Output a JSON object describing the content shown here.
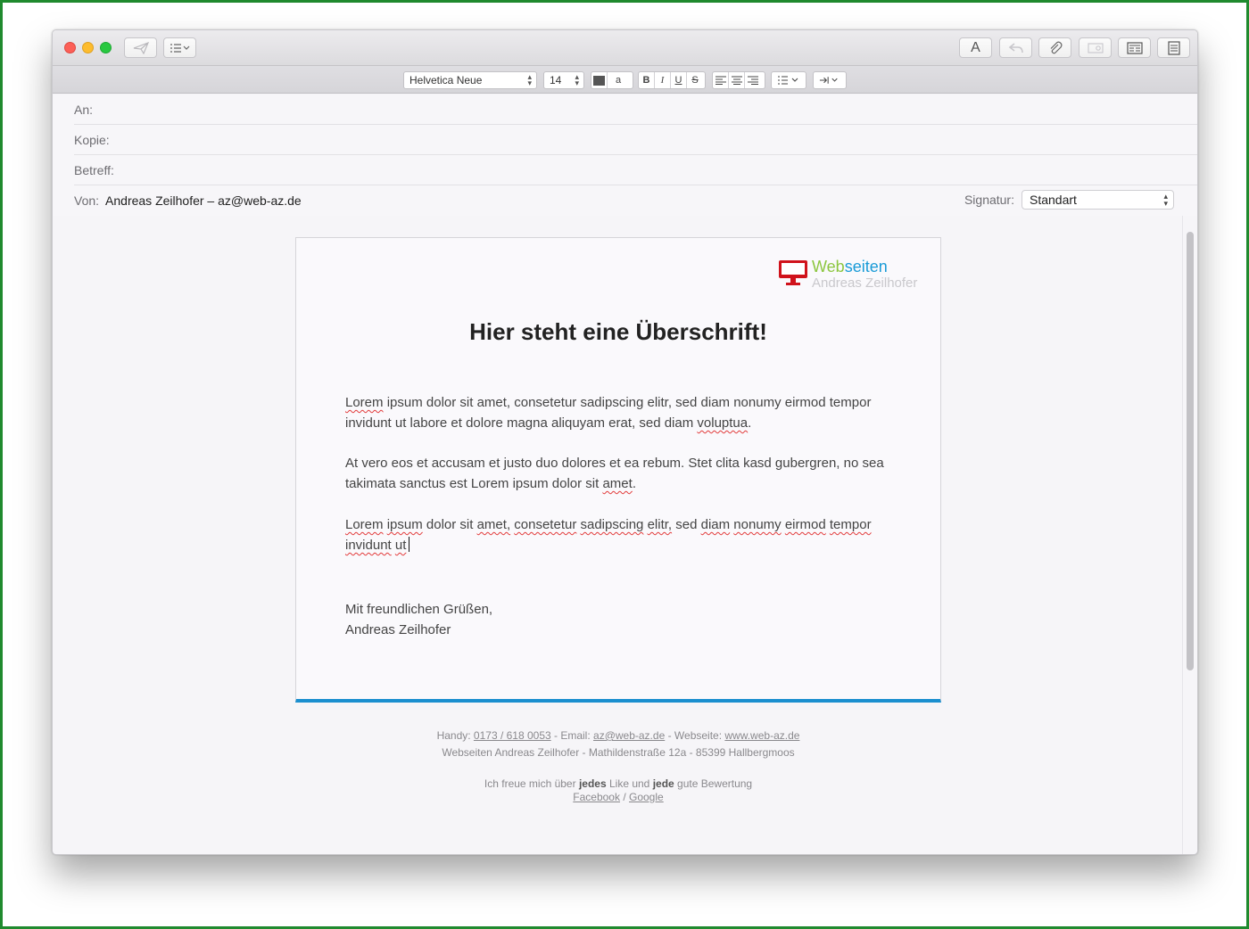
{
  "toolbar": {
    "send_icon": "paper-plane-icon",
    "header_fields_icon": "list-icon",
    "font_icon": "A",
    "reply_icon": "reply-icon",
    "attach_icon": "paperclip-icon",
    "photo_icon": "photo-browser-icon",
    "format_icon": "format-bar-icon",
    "stationery_icon": "stationery-icon"
  },
  "formatbar": {
    "font_family": "Helvetica Neue",
    "font_size": "14",
    "text_color": "#555555",
    "bg_color_label": "a",
    "bold": "B",
    "italic": "I",
    "underline": "U",
    "strike": "S"
  },
  "headers": {
    "to_label": "An:",
    "cc_label": "Kopie:",
    "subject_label": "Betreff:",
    "from_label": "Von:",
    "from_value": "Andreas Zeilhofer – az@web-az.de",
    "signature_label": "Signatur:",
    "signature_value": "Standart"
  },
  "email": {
    "logo": {
      "title_green": "Web",
      "title_blue": "seiten",
      "subtitle": "Andreas Zeilhofer"
    },
    "heading": "Hier steht eine Überschrift!",
    "p1_a": "Lorem",
    "p1_b": " ipsum dolor sit amet, consetetur sadipscing elitr, sed diam nonumy eirmod tempor invidunt ut labore et dolore magna aliquyam erat, sed diam ",
    "p1_c": "voluptua",
    "p1_d": ".",
    "p2_a": " At vero eos et accusam et justo duo dolores et ea rebum. Stet clita kasd gubergren, no sea takimata sanctus est Lorem ipsum dolor sit ",
    "p2_b": "amet",
    "p2_c": ".",
    "p3_w1": "Lorem",
    "p3_w2": "ipsum",
    "p3_w3": "dolor sit",
    "p3_w4": "amet,",
    "p3_w5": "consetetur",
    "p3_w6": "sadipscing",
    "p3_w7": "elitr,",
    "p3_w8": "sed",
    "p3_w9": "diam",
    "p3_w10": "nonumy",
    "p3_w11": "eirmod",
    "p3_w12": "tempor",
    "p3_w13": "invidunt",
    "p3_w14": "ut",
    "closing": "Mit freundlichen Grüßen,",
    "signature_name": "Andreas Zeilhofer",
    "accent_color": "#1b8fcf"
  },
  "footer": {
    "handy_label": "Handy: ",
    "handy_value": "0173 / 618 0053",
    "email_label": " - Email: ",
    "email_value": "az@web-az.de",
    "website_label": " - Webseite: ",
    "website_value": "www.web-az.de",
    "address": "Webseiten Andreas Zeilhofer - Mathildenstraße 12a - 85399 Hallbergmoos",
    "review_1": "Ich freue mich über ",
    "review_bold1": "jedes",
    "review_2": " Like und ",
    "review_bold2": "jede",
    "review_3": " gute Bewertung",
    "facebook": "Facebook",
    "separator": " / ",
    "google": "Google"
  }
}
